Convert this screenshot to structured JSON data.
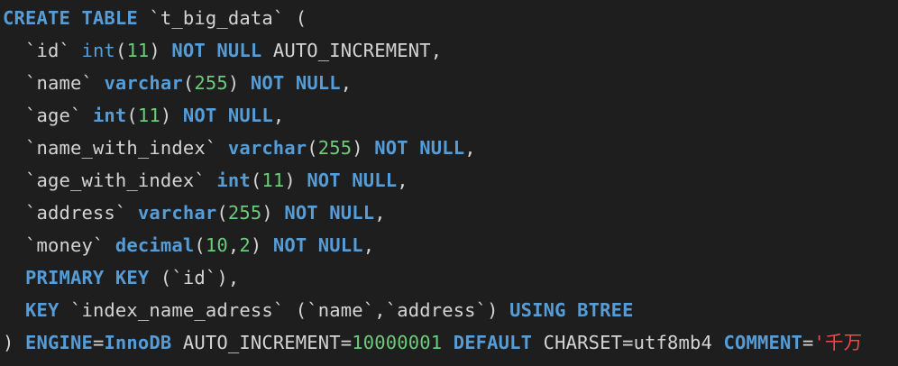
{
  "editor": {
    "language": "sql",
    "colors": {
      "background": "#1e1e1e",
      "keyword": "#569cd6",
      "number": "#6ccb7a",
      "text": "#d4d4d4",
      "string": "#f44747"
    },
    "lines": [
      {
        "name": "create-table-line",
        "tokens": [
          {
            "t": "CREATE TABLE",
            "c": "kw"
          },
          {
            "t": " `t_big_data` (",
            "c": "txt"
          }
        ]
      },
      {
        "name": "column-id-line",
        "tokens": [
          {
            "t": "  `id` ",
            "c": "txt"
          },
          {
            "t": "int",
            "c": "kw2"
          },
          {
            "t": "(",
            "c": "txt"
          },
          {
            "t": "11",
            "c": "num"
          },
          {
            "t": ") ",
            "c": "txt"
          },
          {
            "t": "NOT NULL",
            "c": "kw"
          },
          {
            "t": " AUTO_INCREMENT,",
            "c": "txt"
          }
        ]
      },
      {
        "name": "column-name-line",
        "tokens": [
          {
            "t": "  `name` ",
            "c": "txt"
          },
          {
            "t": "varchar",
            "c": "kw"
          },
          {
            "t": "(",
            "c": "txt"
          },
          {
            "t": "255",
            "c": "num"
          },
          {
            "t": ") ",
            "c": "txt"
          },
          {
            "t": "NOT NULL",
            "c": "kw"
          },
          {
            "t": ",",
            "c": "txt"
          }
        ]
      },
      {
        "name": "column-age-line",
        "tokens": [
          {
            "t": "  `age` ",
            "c": "txt"
          },
          {
            "t": "int",
            "c": "kw"
          },
          {
            "t": "(",
            "c": "txt"
          },
          {
            "t": "11",
            "c": "num"
          },
          {
            "t": ") ",
            "c": "txt"
          },
          {
            "t": "NOT NULL",
            "c": "kw"
          },
          {
            "t": ",",
            "c": "txt"
          }
        ]
      },
      {
        "name": "column-name-with-index-line",
        "tokens": [
          {
            "t": "  `name_with_index` ",
            "c": "txt"
          },
          {
            "t": "varchar",
            "c": "kw"
          },
          {
            "t": "(",
            "c": "txt"
          },
          {
            "t": "255",
            "c": "num"
          },
          {
            "t": ") ",
            "c": "txt"
          },
          {
            "t": "NOT NULL",
            "c": "kw"
          },
          {
            "t": ",",
            "c": "txt"
          }
        ]
      },
      {
        "name": "column-age-with-index-line",
        "tokens": [
          {
            "t": "  `age_with_index` ",
            "c": "txt"
          },
          {
            "t": "int",
            "c": "kw"
          },
          {
            "t": "(",
            "c": "txt"
          },
          {
            "t": "11",
            "c": "num"
          },
          {
            "t": ") ",
            "c": "txt"
          },
          {
            "t": "NOT NULL",
            "c": "kw"
          },
          {
            "t": ",",
            "c": "txt"
          }
        ]
      },
      {
        "name": "column-address-line",
        "tokens": [
          {
            "t": "  `address` ",
            "c": "txt"
          },
          {
            "t": "varchar",
            "c": "kw"
          },
          {
            "t": "(",
            "c": "txt"
          },
          {
            "t": "255",
            "c": "num"
          },
          {
            "t": ") ",
            "c": "txt"
          },
          {
            "t": "NOT NULL",
            "c": "kw"
          },
          {
            "t": ",",
            "c": "txt"
          }
        ]
      },
      {
        "name": "column-money-line",
        "tokens": [
          {
            "t": "  `money` ",
            "c": "txt"
          },
          {
            "t": "decimal",
            "c": "kw"
          },
          {
            "t": "(",
            "c": "txt"
          },
          {
            "t": "10",
            "c": "num"
          },
          {
            "t": ",",
            "c": "txt"
          },
          {
            "t": "2",
            "c": "num"
          },
          {
            "t": ") ",
            "c": "txt"
          },
          {
            "t": "NOT NULL",
            "c": "kw"
          },
          {
            "t": ",",
            "c": "txt"
          }
        ]
      },
      {
        "name": "primary-key-line",
        "tokens": [
          {
            "t": "  ",
            "c": "txt"
          },
          {
            "t": "PRIMARY KEY",
            "c": "kw"
          },
          {
            "t": " (`id`),",
            "c": "txt"
          }
        ]
      },
      {
        "name": "index-key-line",
        "tokens": [
          {
            "t": "  ",
            "c": "txt"
          },
          {
            "t": "KEY",
            "c": "kw"
          },
          {
            "t": " `index_name_adress` (`name`,`address`) ",
            "c": "txt"
          },
          {
            "t": "USING BTREE",
            "c": "kw"
          }
        ]
      },
      {
        "name": "table-options-line",
        "tokens": [
          {
            "t": ") ",
            "c": "txt"
          },
          {
            "t": "ENGINE",
            "c": "kw"
          },
          {
            "t": "=",
            "c": "txt"
          },
          {
            "t": "InnoDB",
            "c": "kw"
          },
          {
            "t": " AUTO_INCREMENT=",
            "c": "txt"
          },
          {
            "t": "10000001",
            "c": "num"
          },
          {
            "t": " ",
            "c": "txt"
          },
          {
            "t": "DEFAULT",
            "c": "kw"
          },
          {
            "t": " CHARSET=utf8mb4 ",
            "c": "txt"
          },
          {
            "t": "COMMENT",
            "c": "kw"
          },
          {
            "t": "=",
            "c": "txt"
          },
          {
            "t": "'千万",
            "c": "str"
          }
        ]
      }
    ]
  }
}
